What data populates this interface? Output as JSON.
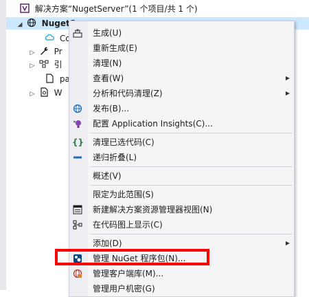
{
  "colors": {
    "selection": "#cce8ff",
    "highlight_box": "#ff0000",
    "menu_bg": "#f5f5f5",
    "menu_border": "#cccedb"
  },
  "solution_explorer": {
    "solution_label": "解决方案“NugetServer”(1 个项目/共 1 个)",
    "project_label": "NugetS",
    "items": [
      {
        "label": "Co",
        "icon": "cloud-icon"
      },
      {
        "label": "Pr",
        "icon": "wrench-icon"
      },
      {
        "label": "引",
        "icon": "references-icon"
      },
      {
        "label": "pa",
        "icon": "file-icon"
      },
      {
        "label": "W",
        "icon": "config-icon"
      }
    ]
  },
  "context_menu": {
    "items": [
      {
        "label": "生成(U)",
        "icon": "build-icon"
      },
      {
        "label": "重新生成(E)"
      },
      {
        "label": "清理(N)"
      },
      {
        "label": "查看(W)",
        "submenu": true
      },
      {
        "label": "分析和代码清理(Z)",
        "submenu": true
      },
      {
        "label": "发布(B)...",
        "icon": "publish-globe-icon"
      },
      {
        "label": "配置 Application Insights(C)...",
        "icon": "insights-icon"
      },
      {
        "label": "清理已选代码(C)",
        "icon": "braces-icon"
      },
      {
        "label": "递归折叠(L)",
        "icon": "collapse-icon"
      },
      {
        "label": "概述(V)"
      },
      {
        "label": "限定为此范围(S)"
      },
      {
        "label": "新建解决方案资源管理器视图(N)",
        "icon": "new-view-icon"
      },
      {
        "label": "在代码图上显示(C)",
        "icon": "code-map-icon"
      },
      {
        "label": "添加(D)",
        "submenu": true
      },
      {
        "label": "管理 NuGet 程序包(N)...",
        "icon": "nuget-icon"
      },
      {
        "label": "管理客户端库(M)...",
        "icon": "client-lib-icon"
      },
      {
        "label": "管理用户机密(G)"
      }
    ]
  }
}
